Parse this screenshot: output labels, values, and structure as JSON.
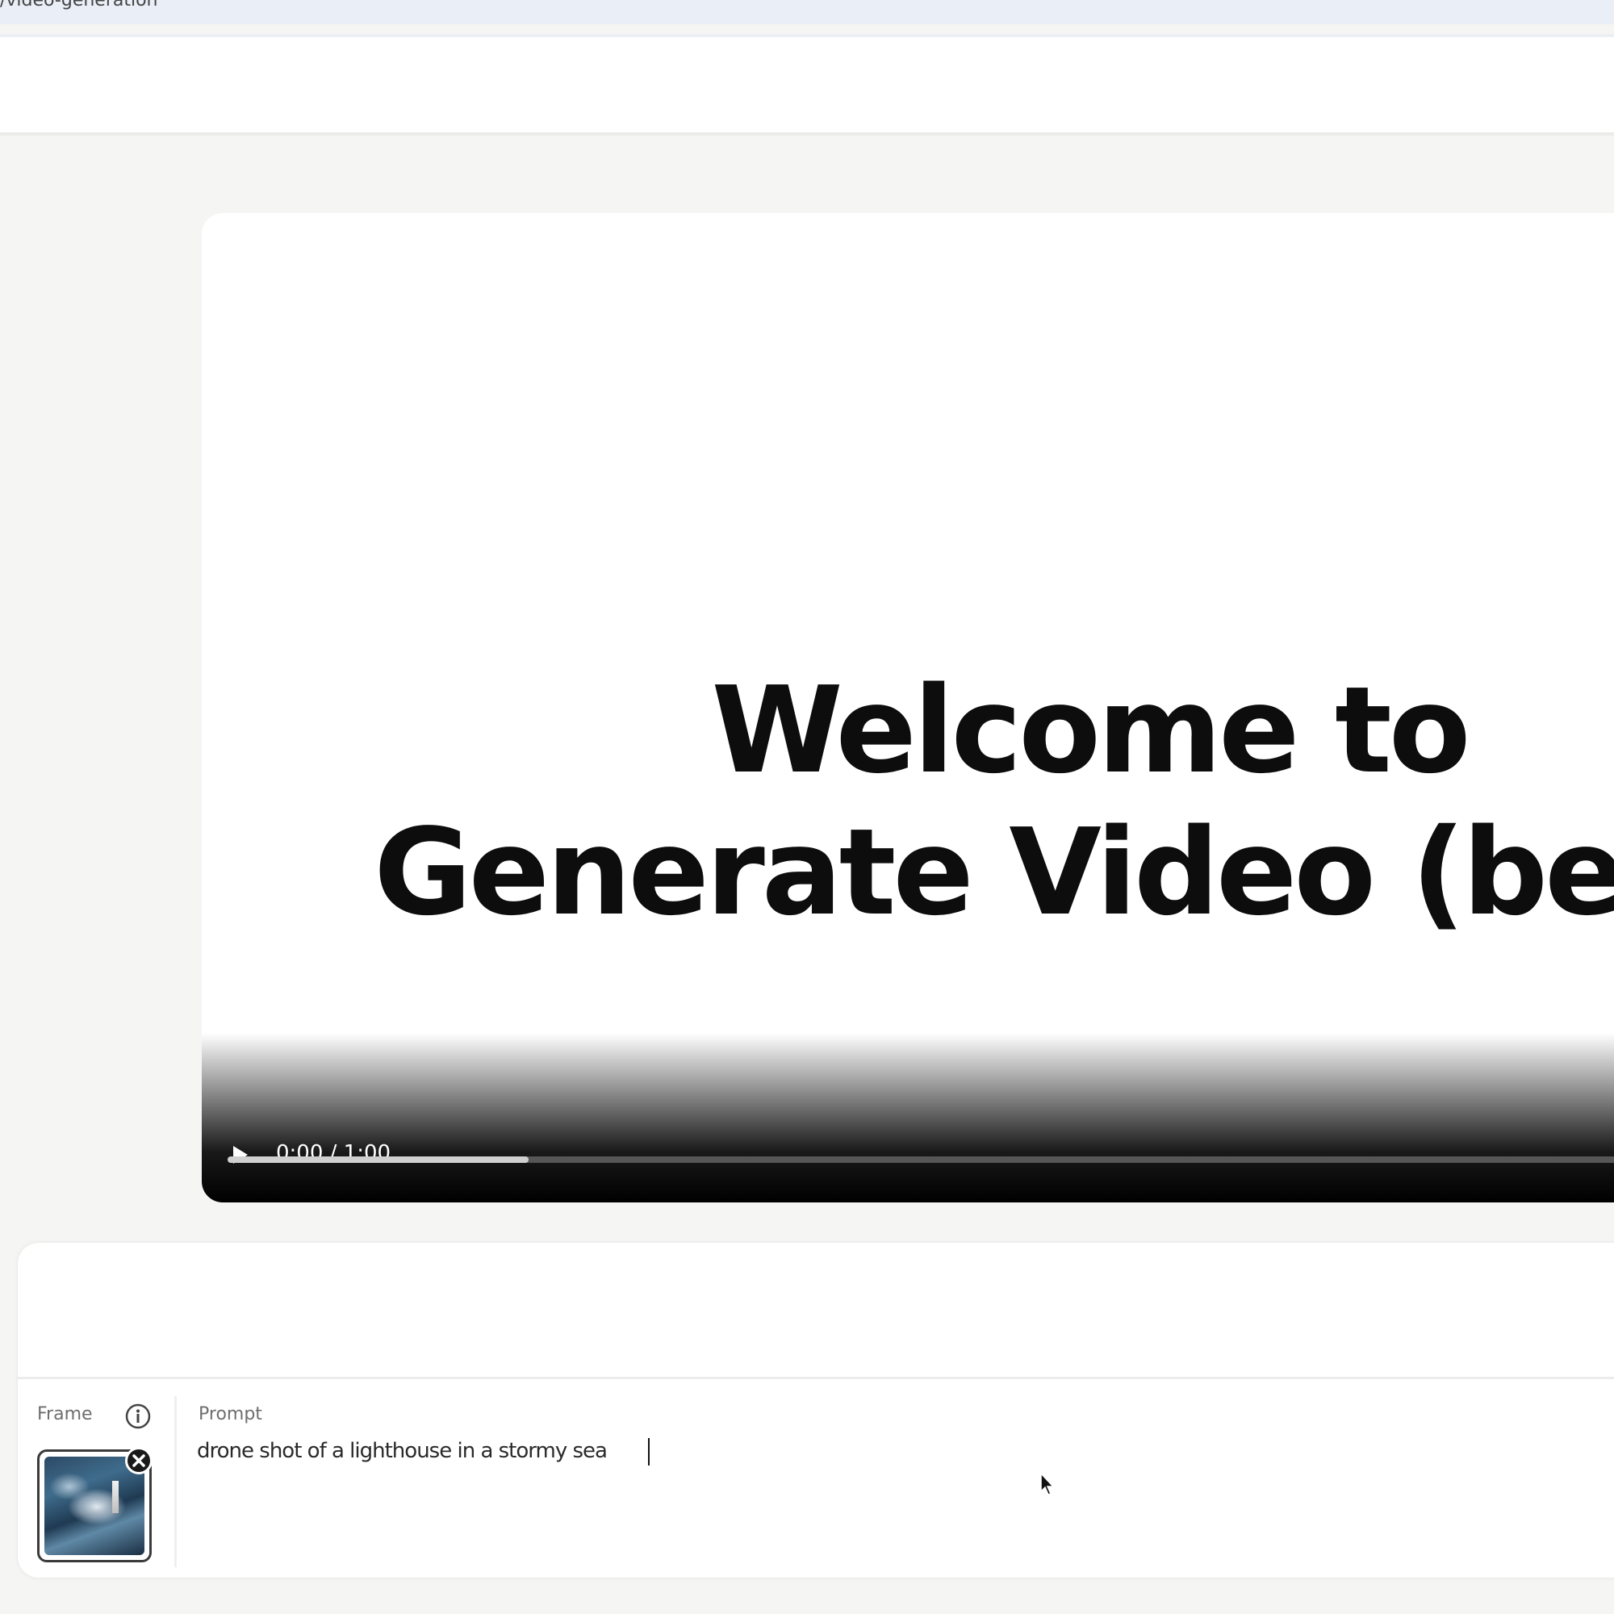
{
  "browser": {
    "url_text": "/video-generation"
  },
  "video": {
    "title_line1": "Welcome to",
    "title_line2": "Generate Video (beta)",
    "time_display": "0:00 / 1:00",
    "progress_fraction": 0.205,
    "icons": {
      "play": "play-icon"
    }
  },
  "prompt_panel": {
    "frame_label": "Frame",
    "prompt_label": "Prompt",
    "prompt_value": "drone shot of a lighthouse in a stormy sea",
    "icons": {
      "info": "info-icon",
      "remove_frame": "close-icon",
      "frame_thumbnail": "stormy-sea-lighthouse-thumbnail"
    }
  },
  "colors": {
    "page_background": "#f5f5f4",
    "player_controls": "#000000",
    "title_text": "#0d0d0d"
  }
}
